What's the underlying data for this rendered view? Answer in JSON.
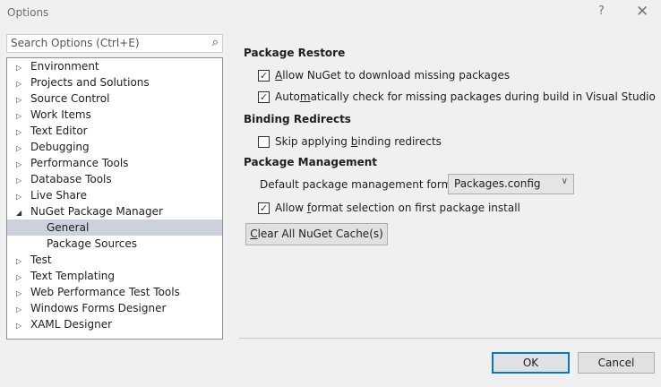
{
  "window": {
    "title": "Options",
    "help": "?",
    "close": "✕"
  },
  "search": {
    "placeholder": "Search Options (Ctrl+E)"
  },
  "tree": [
    {
      "label": "Environment",
      "expanded": false
    },
    {
      "label": "Projects and Solutions",
      "expanded": false
    },
    {
      "label": "Source Control",
      "expanded": false
    },
    {
      "label": "Work Items",
      "expanded": false
    },
    {
      "label": "Text Editor",
      "expanded": false
    },
    {
      "label": "Debugging",
      "expanded": false
    },
    {
      "label": "Performance Tools",
      "expanded": false
    },
    {
      "label": "Database Tools",
      "expanded": false
    },
    {
      "label": "Live Share",
      "expanded": false
    },
    {
      "label": "NuGet Package Manager",
      "expanded": true
    },
    {
      "label": "General",
      "child": true,
      "selected": true
    },
    {
      "label": "Package Sources",
      "child": true
    },
    {
      "label": "Test",
      "expanded": false
    },
    {
      "label": "Text Templating",
      "expanded": false
    },
    {
      "label": "Web Performance Test Tools",
      "expanded": false
    },
    {
      "label": "Windows Forms Designer",
      "expanded": false
    },
    {
      "label": "XAML Designer",
      "expanded": false
    }
  ],
  "settings": {
    "restore_heading": "Package Restore",
    "allow_download": {
      "pre": "",
      "ul": "A",
      "post": "llow NuGet to download missing packages",
      "checked": true
    },
    "auto_check": {
      "pre": "Auto",
      "ul": "m",
      "post": "atically check for missing packages during build in Visual Studio",
      "checked": true
    },
    "binding_heading": "Binding Redirects",
    "skip_binding": {
      "pre": "Skip applying ",
      "ul": "b",
      "post": "inding redirects",
      "checked": false
    },
    "mgmt_heading": "Package Management",
    "format_label": "Default package management format:",
    "format_value": "Packages.config",
    "allow_format": {
      "pre": "Allow ",
      "ul": "f",
      "post": "ormat selection on first package install",
      "checked": true
    },
    "clear_cache": {
      "ul": "C",
      "post": "lear All NuGet Cache(s)"
    }
  },
  "buttons": {
    "ok": "OK",
    "cancel": "Cancel"
  }
}
